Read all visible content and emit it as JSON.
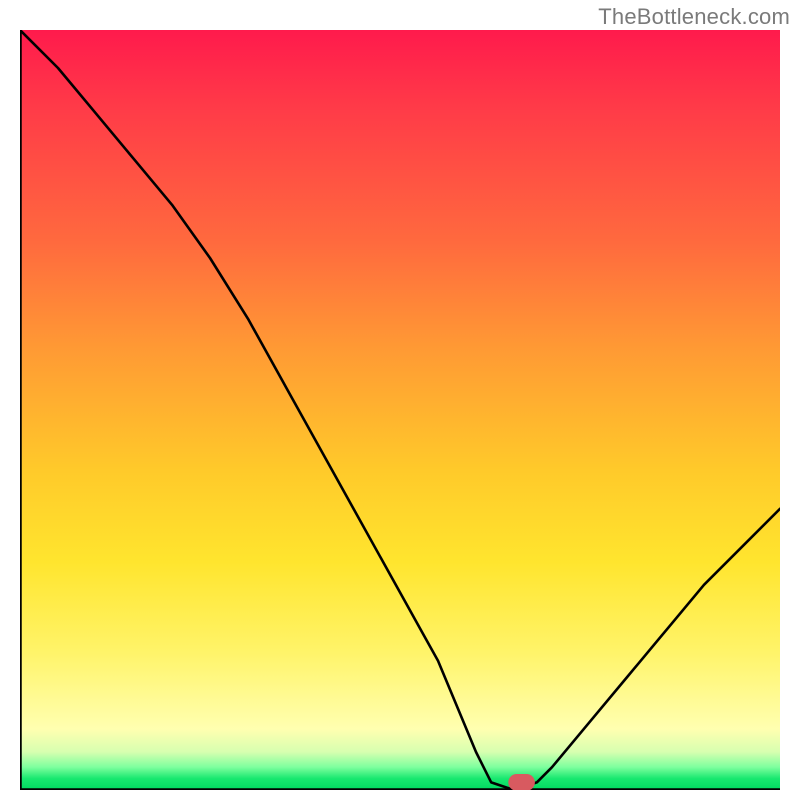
{
  "attribution": "TheBottleneck.com",
  "chart_data": {
    "type": "line",
    "title": "",
    "xlabel": "",
    "ylabel": "",
    "xlim": [
      0,
      100
    ],
    "ylim": [
      0,
      100
    ],
    "grid": false,
    "legend": false,
    "curve_description": "V-shaped bottleneck curve: starts near 100% at x≈0, falls steeply with a slight slope change near x≈25 (y≈70), reaches a flat minimum of ≈0 around x≈62–68, then rises to ≈37 at x=100.",
    "series": [
      {
        "name": "bottleneck-pct",
        "x": [
          0,
          5,
          10,
          15,
          20,
          25,
          30,
          35,
          40,
          45,
          50,
          55,
          60,
          62,
          65,
          68,
          70,
          75,
          80,
          85,
          90,
          95,
          100
        ],
        "y": [
          100,
          95,
          89,
          83,
          77,
          70,
          62,
          53,
          44,
          35,
          26,
          17,
          5,
          1,
          0,
          1,
          3,
          9,
          15,
          21,
          27,
          32,
          37
        ]
      }
    ],
    "markers": [
      {
        "name": "optimal-point",
        "x": 66,
        "y": 0.5,
        "color": "#d85a60",
        "shape": "rounded-rect"
      }
    ],
    "background_gradient": {
      "direction": "vertical",
      "stops": [
        {
          "pos": 0.0,
          "color": "#ff1a4c"
        },
        {
          "pos": 0.28,
          "color": "#ff6a3e"
        },
        {
          "pos": 0.58,
          "color": "#ffca2a"
        },
        {
          "pos": 0.82,
          "color": "#fff46a"
        },
        {
          "pos": 0.95,
          "color": "#d7ffb0"
        },
        {
          "pos": 1.0,
          "color": "#00d860"
        }
      ]
    }
  }
}
